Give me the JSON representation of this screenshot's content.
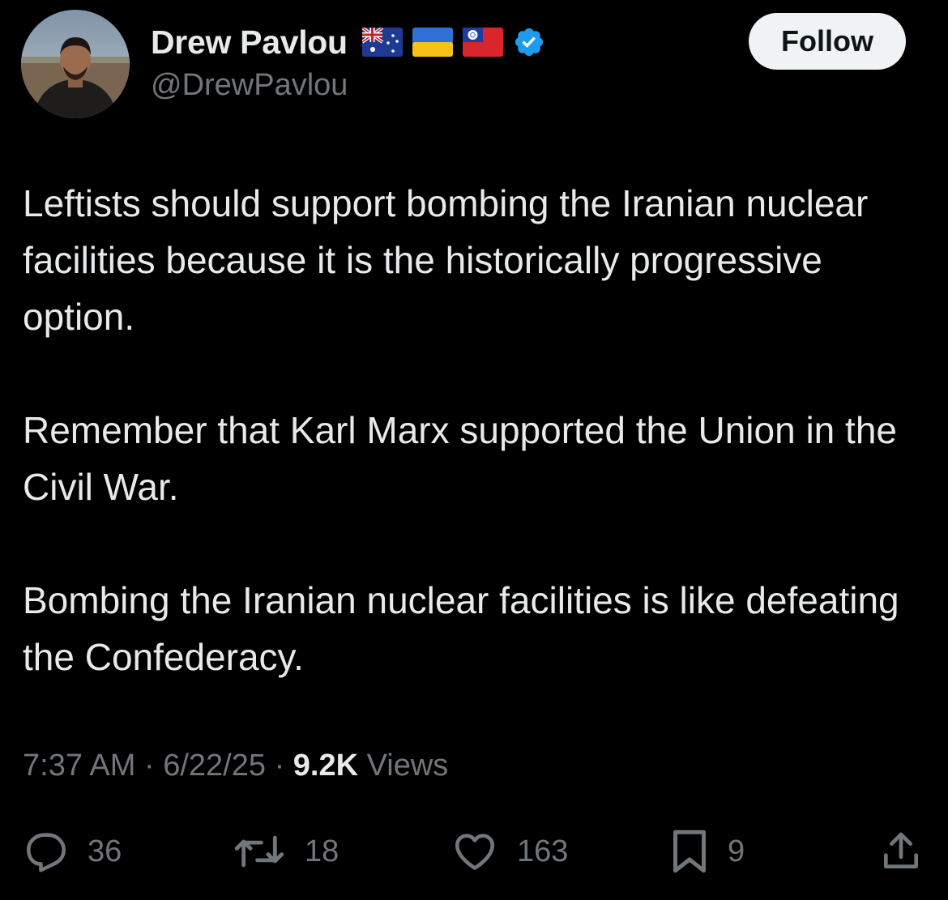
{
  "author": {
    "display_name": "Drew Pavlou",
    "handle": "@DrewPavlou",
    "flags": [
      "australia-flag-icon",
      "ukraine-flag-icon",
      "taiwan-flag-icon"
    ],
    "verified_icon": "verified-badge-icon",
    "verified_color": "#1d9bf0"
  },
  "follow_button": {
    "label": "Follow"
  },
  "tweet": {
    "paragraphs": [
      "Leftists should support bombing the Iranian nuclear facilities because it is the historically progressive option.",
      "Remember that Karl Marx supported the Union in the Civil War.",
      "Bombing the Iranian nuclear facilities is like defeating the Confederacy."
    ]
  },
  "meta": {
    "time": "7:37 AM",
    "separator": "·",
    "date": "6/22/25",
    "views_count": "9.2K",
    "views_label": "Views"
  },
  "actions": {
    "replies": {
      "icon": "reply-icon",
      "count": "36"
    },
    "reposts": {
      "icon": "repost-icon",
      "count": "18"
    },
    "likes": {
      "icon": "heart-icon",
      "count": "163"
    },
    "bookmarks": {
      "icon": "bookmark-icon",
      "count": "9"
    },
    "share": {
      "icon": "share-icon"
    }
  },
  "colors": {
    "background": "#000000",
    "primary_text": "#e7e9ea",
    "secondary_text": "#71767b",
    "follow_bg": "#eff3f4"
  }
}
